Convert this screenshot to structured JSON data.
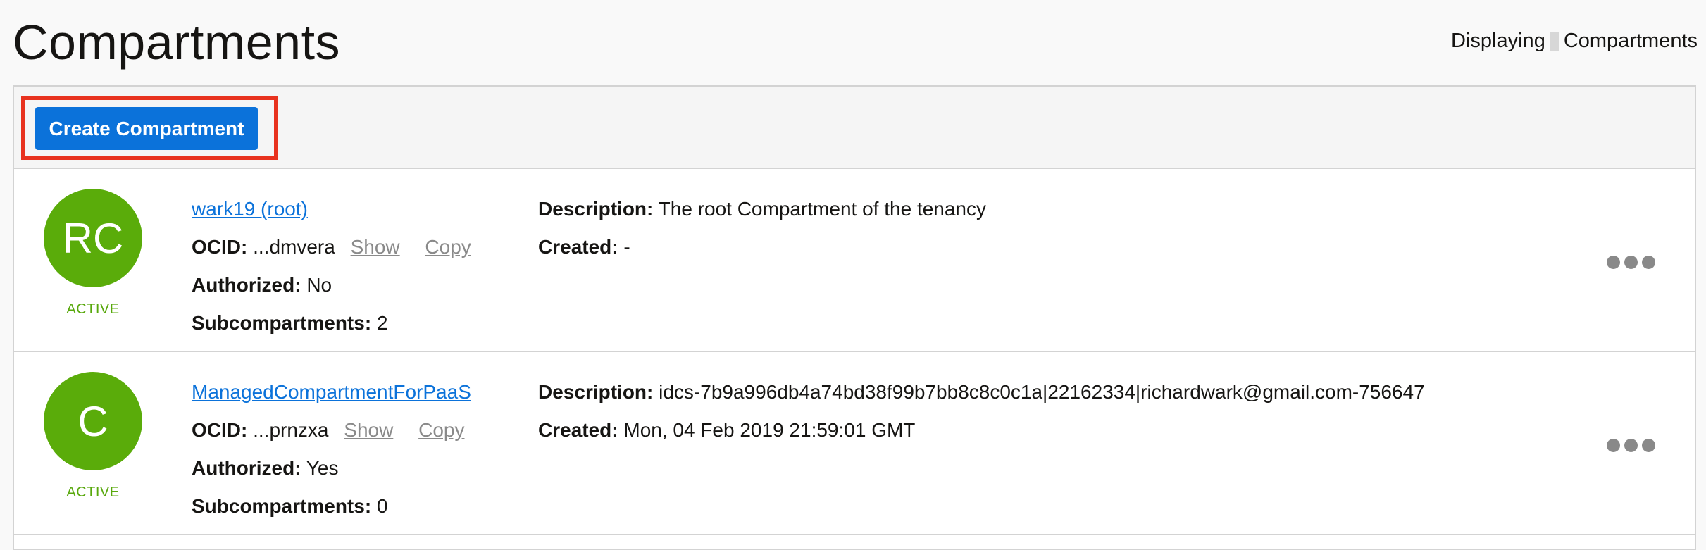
{
  "header": {
    "title": "Compartments",
    "display_prefix": "Displaying",
    "display_suffix": "Compartments"
  },
  "toolbar": {
    "create_label": "Create Compartment"
  },
  "compartments": [
    {
      "initials": "RC",
      "status": "ACTIVE",
      "name": "wark19 (root)",
      "ocid_label": "OCID:",
      "ocid": "...dmvera",
      "show_label": "Show",
      "copy_label": "Copy",
      "authorized_label": "Authorized:",
      "authorized": "No",
      "subcompartments_label": "Subcompartments:",
      "subcompartments": "2",
      "description_label": "Description:",
      "description": "The root Compartment of the tenancy",
      "created_label": "Created:",
      "created": "-"
    },
    {
      "initials": "C",
      "status": "ACTIVE",
      "name": "ManagedCompartmentForPaaS",
      "ocid_label": "OCID:",
      "ocid": "...prnzxa",
      "show_label": "Show",
      "copy_label": "Copy",
      "authorized_label": "Authorized:",
      "authorized": "Yes",
      "subcompartments_label": "Subcompartments:",
      "subcompartments": "0",
      "description_label": "Description:",
      "description": "idcs-7b9a996db4a74bd38f99b7bb8c8c0c1a|22162334|richardwark@gmail.com-756647",
      "created_label": "Created:",
      "created": "Mon, 04 Feb 2019 21:59:01 GMT"
    }
  ],
  "colors": {
    "accent": "#0b72da",
    "status_active": "#5aac0a",
    "highlight": "#e8321e"
  },
  "icons": {
    "actions_menu": "more-horizontal-icon"
  }
}
